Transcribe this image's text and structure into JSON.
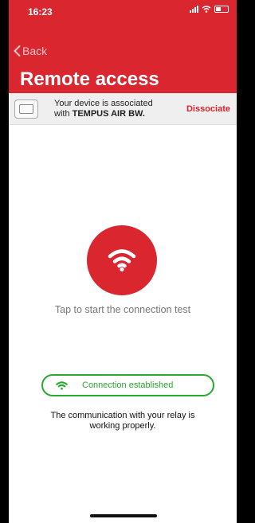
{
  "status_bar": {
    "time": "16:23"
  },
  "nav": {
    "back_label": "Back",
    "title": "Remote access"
  },
  "device": {
    "line1": "Your device is associated",
    "line2_prefix": "with ",
    "device_name": "TEMPUS AIR BW.",
    "dissociate_label": "Dissociate"
  },
  "main": {
    "tap_text": "Tap to start the connection test",
    "status_label": "Connection established",
    "comm_line1": "The communication with your relay is",
    "comm_line2": "working properly."
  },
  "colors": {
    "brand_red": "#d9262f",
    "success_green": "#27a82e"
  },
  "icons": {
    "back": "chevron-left-icon",
    "wifi": "wifi-icon",
    "battery": "battery-icon"
  }
}
